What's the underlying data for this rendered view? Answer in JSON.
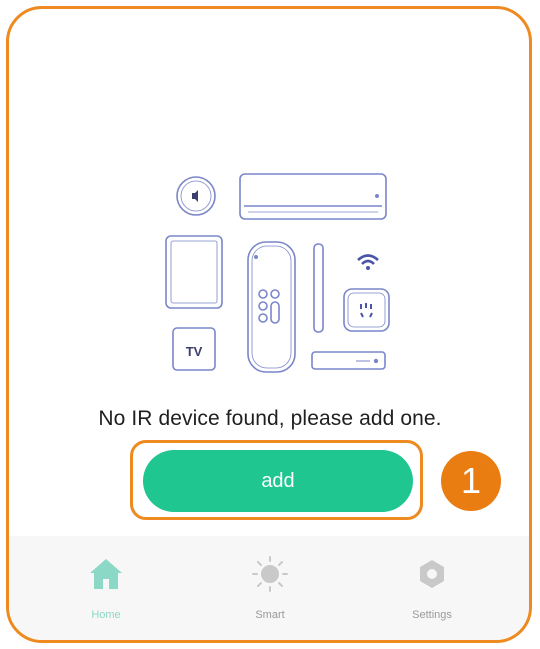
{
  "empty_state": {
    "message": "No IR device found,  please add one.",
    "illustration_devices": [
      "speaker-icon",
      "air-conditioner-icon",
      "tablet-icon",
      "remote-control-icon",
      "wifi-icon",
      "smart-plug-icon",
      "tv-icon",
      "set-top-box-icon"
    ],
    "tv_label": "TV"
  },
  "add_button": {
    "label": "add"
  },
  "annotation": {
    "step_number": "1"
  },
  "tabs": [
    {
      "label": "Home",
      "icon": "home-icon",
      "active": true
    },
    {
      "label": "Smart",
      "icon": "sun-icon",
      "active": false
    },
    {
      "label": "Settings",
      "icon": "hexagon-settings-icon",
      "active": false
    }
  ],
  "colors": {
    "accent_green": "#1fc690",
    "annotation_orange": "#ee8a1f",
    "line_art_blue": "#7a86c9",
    "active_tab": "#8ad8c5",
    "inactive_tab": "#c9c9c9"
  }
}
